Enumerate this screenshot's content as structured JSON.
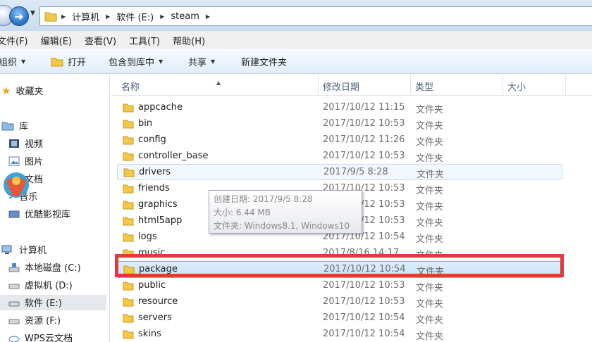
{
  "breadcrumb": [
    "计算机",
    "软件 (E:)",
    "steam"
  ],
  "menu": [
    "文件(F)",
    "编辑(E)",
    "查看(V)",
    "工具(T)",
    "帮助(H)"
  ],
  "toolbar": {
    "organize": "组织",
    "open": "打开",
    "include": "包含到库中",
    "share": "共享",
    "new_folder": "新建文件夹"
  },
  "nav": {
    "favorites": "收藏夹",
    "libraries": "库",
    "videos": "视频",
    "pictures": "图片",
    "docs": "文档",
    "music": "音乐",
    "youku": "优酷影视库",
    "computer": "计算机",
    "drive_c": "本地磁盘 (C:)",
    "drive_d": "虚拟机 (D:)",
    "drive_e": "软件 (E:)",
    "drive_f": "资源 (F:)",
    "wps": "WPS云文档"
  },
  "columns": {
    "name": "名称",
    "date": "修改日期",
    "type": "类型",
    "size": "大小"
  },
  "files": [
    {
      "name": "appcache",
      "date": "2017/10/12 11:15",
      "type": "文件夹"
    },
    {
      "name": "bin",
      "date": "2017/10/12 10:53",
      "type": "文件夹"
    },
    {
      "name": "config",
      "date": "2017/10/12 11:26",
      "type": "文件夹"
    },
    {
      "name": "controller_base",
      "date": "2017/10/12 10:53",
      "type": "文件夹"
    },
    {
      "name": "drivers",
      "date": "2017/9/5 8:28",
      "type": "文件夹"
    },
    {
      "name": "friends",
      "date": "2017/10/12 10:53",
      "type": "文件夹"
    },
    {
      "name": "graphics",
      "date": "2017/10/12 10:53",
      "type": "文件夹"
    },
    {
      "name": "html5app",
      "date": "2017/10/12 10:53",
      "type": "文件夹"
    },
    {
      "name": "logs",
      "date": "2017/10/12 10:54",
      "type": "文件夹"
    },
    {
      "name": "music",
      "date": "2017/8/16 14:17",
      "type": "文件夹"
    },
    {
      "name": "package",
      "date": "2017/10/12 10:54",
      "type": "文件夹"
    },
    {
      "name": "public",
      "date": "2017/10/12 10:53",
      "type": "文件夹"
    },
    {
      "name": "resource",
      "date": "2017/10/12 10:53",
      "type": "文件夹"
    },
    {
      "name": "servers",
      "date": "2017/10/12 10:54",
      "type": "文件夹"
    },
    {
      "name": "skins",
      "date": "2017/10/12 10:54",
      "type": "文件夹"
    }
  ],
  "tooltip": {
    "created": "创建日期: 2017/9/5 8:28",
    "size": "大小: 6.44 MB",
    "files": "文件夹: Windows8.1, Windows10"
  },
  "colors": {
    "highlight_red": "#e23a3a",
    "selection_blue": "#c6e1fb",
    "folder_yellow": "#f3c74a"
  }
}
